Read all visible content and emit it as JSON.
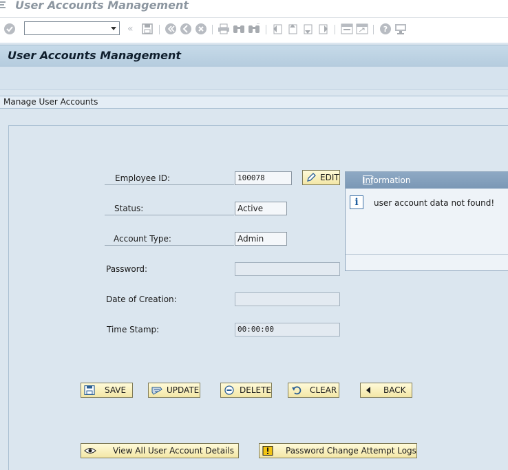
{
  "window": {
    "title": "User Accounts Management"
  },
  "toolbar": {
    "command_value": "",
    "icons": [
      "check-icon",
      "save-icon",
      "back-icon",
      "exit-icon",
      "cancel-icon",
      "print-icon",
      "find-icon",
      "find-next-icon",
      "first-page-icon",
      "previous-page-icon",
      "next-page-icon",
      "last-page-icon",
      "create-session-icon",
      "shortcut-icon",
      "help-icon",
      "layout-icon"
    ]
  },
  "header": {
    "title": "User Accounts Management"
  },
  "group": {
    "title": "Manage User Accounts"
  },
  "form": {
    "employee_id_label": "Employee ID:",
    "employee_id_value": "100078",
    "edit_label": "EDIT",
    "status_label": "Status:",
    "status_value": "Active",
    "account_type_label": "Account Type:",
    "account_type_value": "Admin",
    "password_label": "Password:",
    "password_value": "",
    "creation_label": "Date of Creation:",
    "creation_value": "",
    "timestamp_label": "Time Stamp:",
    "timestamp_value": "00:00:00"
  },
  "actions": {
    "save": "SAVE",
    "update": "UPDATE",
    "delete": "DELETE",
    "clear": "CLEAR",
    "back": "BACK",
    "view_all": "View All User Account Details",
    "password_logs": "Password Change Attempt Logs"
  },
  "info_dialog": {
    "title": "Information",
    "message": "user account data not found!"
  },
  "colors": {
    "header_band": "#b5ccde",
    "button_face": "#f3e7a6",
    "dialog_title": "#7a97b5"
  }
}
